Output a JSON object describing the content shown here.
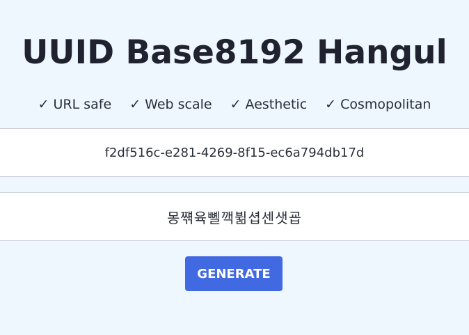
{
  "header": {
    "title": "UUID Base8192 Hangul"
  },
  "features": [
    "✓ URL safe",
    "✓ Web scale",
    "✓ Aesthetic",
    "✓ Cosmopolitan"
  ],
  "uuid_field": {
    "value": "f2df516c-e281-4269-8f15-ec6a794db17d"
  },
  "hangul_field": {
    "value": "몽쨲육뼬깩뷞셥센샛굡"
  },
  "actions": {
    "generate_label": "GENERATE"
  },
  "colors": {
    "background": "#eef6fe",
    "button": "#4169e1",
    "field_bg": "#ffffff"
  }
}
